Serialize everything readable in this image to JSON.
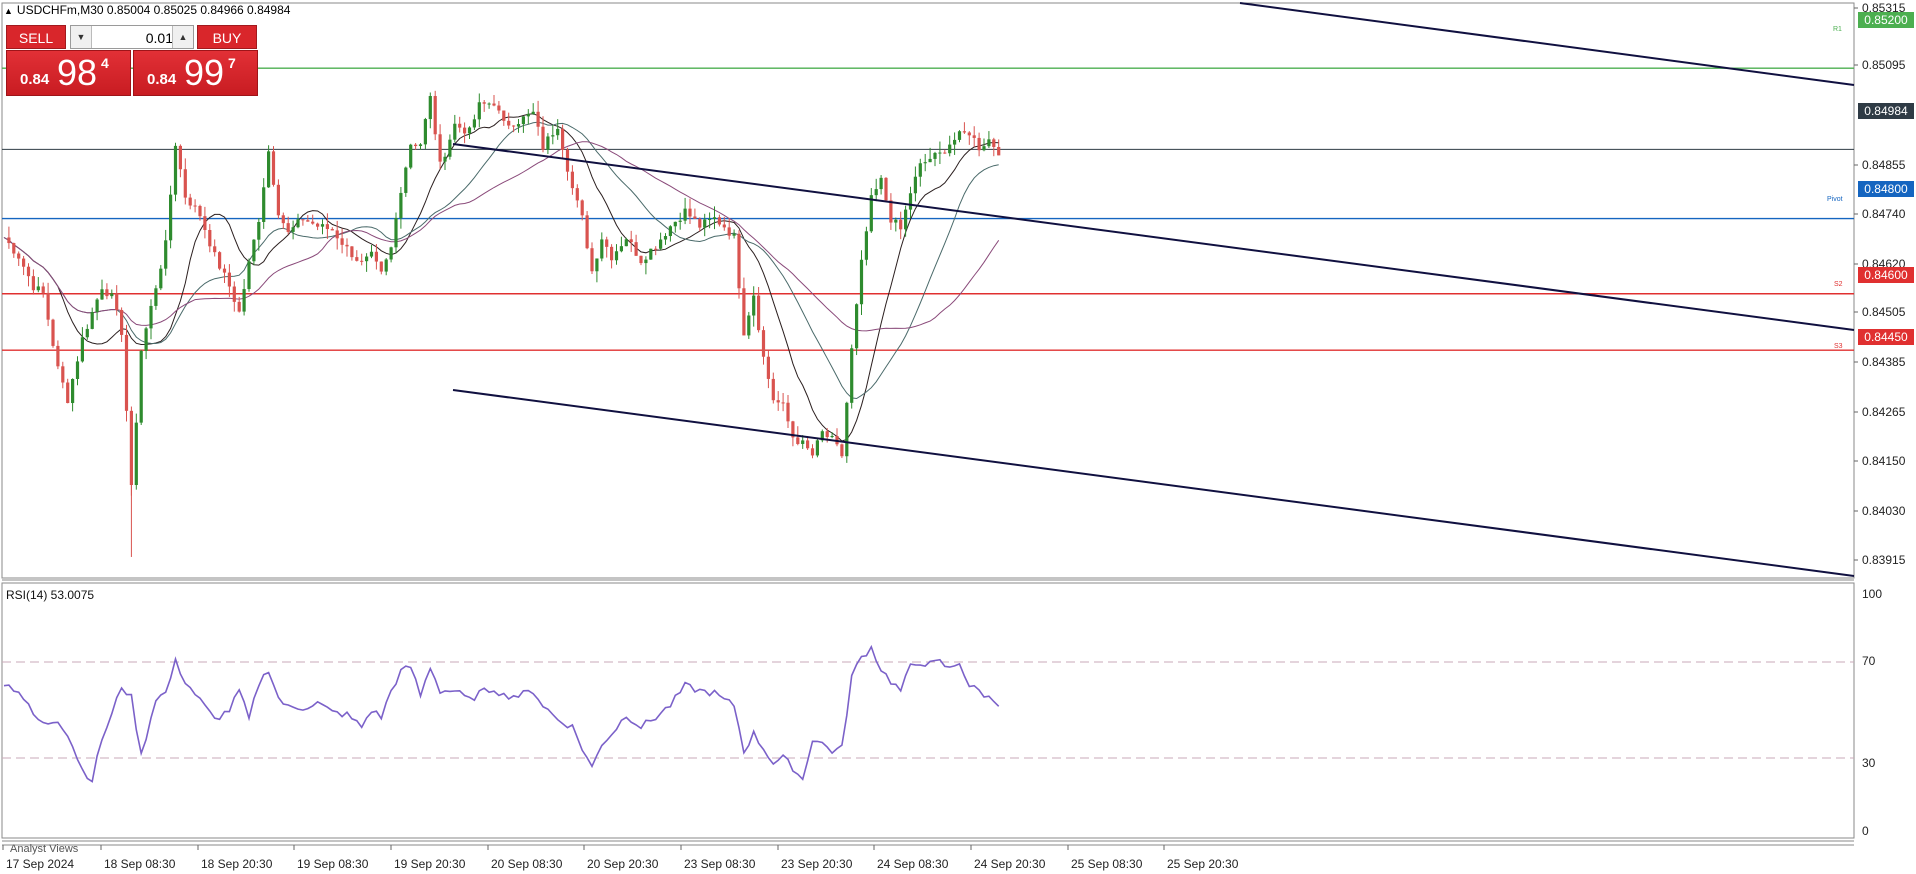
{
  "symbol_bar": {
    "text": "USDCHFm,M30  0.85004 0.85025 0.84966 0.84984"
  },
  "trade_panel": {
    "sell_label": "SELL",
    "buy_label": "BUY",
    "lot_value": "0.01",
    "sell_price": {
      "prefix": "0.84",
      "big": "98",
      "sup": "4"
    },
    "buy_price": {
      "prefix": "0.84",
      "big": "99",
      "sup": "7"
    }
  },
  "colors": {
    "bull": "#2e8b2e",
    "bear": "#d9534f",
    "r1": "#4caf50",
    "pivot": "#1565c0",
    "support": "#e03030",
    "current": "#2f3b45",
    "channel": "#101040",
    "rsi": "#7b61c9",
    "ma_fast": "#2b1f1f",
    "ma_mid": "#4a6a6a",
    "ma_slow": "#8a4a7a"
  },
  "level_tags": {
    "r1": {
      "price": "0.85200",
      "label": "R1"
    },
    "pivot": {
      "price": "0.84800",
      "label": "Pivot"
    },
    "s2": {
      "price": "0.84600",
      "label": "S2"
    },
    "s3": {
      "price": "0.84450",
      "label": "S3"
    },
    "current": {
      "price": "0.84984"
    }
  },
  "rsi_panel": {
    "title": "RSI(14) 53.0075",
    "levels": [
      "100",
      "70",
      "30",
      "0"
    ]
  },
  "analyst_views": "Analyst Views",
  "chart_data": [
    {
      "type": "candlestick",
      "title": "USDCHFm,M30",
      "ylim": [
        0.8386,
        0.8536
      ],
      "y_ticks": [
        "0.85315",
        "0.85095",
        "0.84855",
        "0.84740",
        "0.84620",
        "0.84505",
        "0.84385",
        "0.84265",
        "0.84150",
        "0.84030",
        "0.83915"
      ],
      "x_ticks": [
        "17 Sep 2024",
        "18 Sep 08:30",
        "18 Sep 20:30",
        "19 Sep 08:30",
        "19 Sep 20:30",
        "20 Sep 08:30",
        "20 Sep 20:30",
        "23 Sep 08:30",
        "23 Sep 20:30",
        "24 Sep 08:30",
        "24 Sep 20:30",
        "25 Sep 08:30",
        "25 Sep 20:30"
      ],
      "price_path": [
        [
          0,
          0.8475
        ],
        [
          3,
          0.847
        ],
        [
          6,
          0.8462
        ],
        [
          8,
          0.846
        ],
        [
          11,
          0.844
        ],
        [
          13,
          0.8432
        ],
        [
          16,
          0.8448
        ],
        [
          20,
          0.8462
        ],
        [
          22,
          0.8459
        ],
        [
          24,
          0.845
        ],
        [
          26,
          0.8408
        ],
        [
          28,
          0.8445
        ],
        [
          31,
          0.8462
        ],
        [
          33,
          0.8473
        ],
        [
          35,
          0.85
        ],
        [
          37,
          0.8486
        ],
        [
          40,
          0.8481
        ],
        [
          43,
          0.847
        ],
        [
          46,
          0.8462
        ],
        [
          48,
          0.8455
        ],
        [
          50,
          0.8468
        ],
        [
          52,
          0.848
        ],
        [
          54,
          0.8498
        ],
        [
          56,
          0.8482
        ],
        [
          58,
          0.8476
        ],
        [
          61,
          0.848
        ],
        [
          64,
          0.8478
        ],
        [
          67,
          0.8477
        ],
        [
          70,
          0.8472
        ],
        [
          73,
          0.8468
        ],
        [
          75,
          0.847
        ],
        [
          77,
          0.8465
        ],
        [
          79,
          0.8472
        ],
        [
          81,
          0.8488
        ],
        [
          83,
          0.85
        ],
        [
          85,
          0.85
        ],
        [
          87,
          0.8512
        ],
        [
          89,
          0.8494
        ],
        [
          92,
          0.8505
        ],
        [
          95,
          0.8503
        ],
        [
          97,
          0.851
        ],
        [
          100,
          0.8511
        ],
        [
          102,
          0.8505
        ],
        [
          105,
          0.8506
        ],
        [
          108,
          0.8508
        ],
        [
          110,
          0.8499
        ],
        [
          113,
          0.8505
        ],
        [
          116,
          0.8488
        ],
        [
          118,
          0.848
        ],
        [
          120,
          0.8466
        ],
        [
          122,
          0.8475
        ],
        [
          124,
          0.847
        ],
        [
          127,
          0.8475
        ],
        [
          130,
          0.8469
        ],
        [
          133,
          0.8473
        ],
        [
          136,
          0.8478
        ],
        [
          139,
          0.8482
        ],
        [
          142,
          0.8478
        ],
        [
          145,
          0.848
        ],
        [
          147,
          0.8478
        ],
        [
          149,
          0.8475
        ],
        [
          151,
          0.845
        ],
        [
          153,
          0.846
        ],
        [
          155,
          0.8443
        ],
        [
          157,
          0.8432
        ],
        [
          159,
          0.843
        ],
        [
          161,
          0.8422
        ],
        [
          163,
          0.842
        ],
        [
          165,
          0.8417
        ],
        [
          167,
          0.8423
        ],
        [
          169,
          0.8421
        ],
        [
          171,
          0.8417
        ],
        [
          173,
          0.8445
        ],
        [
          175,
          0.8468
        ],
        [
          177,
          0.8485
        ],
        [
          179,
          0.849
        ],
        [
          181,
          0.848
        ],
        [
          183,
          0.8477
        ],
        [
          185,
          0.8487
        ],
        [
          187,
          0.8494
        ],
        [
          189,
          0.8496
        ],
        [
          191,
          0.8497
        ],
        [
          193,
          0.85
        ],
        [
          195,
          0.8502
        ],
        [
          197,
          0.8503
        ],
        [
          199,
          0.8499
        ],
        [
          201,
          0.8501
        ],
        [
          203,
          0.8498
        ]
      ]
    },
    {
      "type": "line",
      "title": "RSI(14) 53.0075",
      "ylim": [
        0,
        100
      ],
      "guide_levels": [
        70,
        30
      ],
      "path": [
        [
          0,
          61
        ],
        [
          3,
          58
        ],
        [
          6,
          48
        ],
        [
          8,
          44
        ],
        [
          11,
          46
        ],
        [
          13,
          40
        ],
        [
          16,
          25
        ],
        [
          18,
          21
        ],
        [
          20,
          38
        ],
        [
          22,
          48
        ],
        [
          24,
          60
        ],
        [
          26,
          55
        ],
        [
          28,
          31
        ],
        [
          31,
          55
        ],
        [
          33,
          57
        ],
        [
          35,
          70
        ],
        [
          37,
          62
        ],
        [
          40,
          54
        ],
        [
          43,
          46
        ],
        [
          46,
          50
        ],
        [
          48,
          58
        ],
        [
          50,
          46
        ],
        [
          52,
          61
        ],
        [
          54,
          67
        ],
        [
          56,
          55
        ],
        [
          58,
          51
        ],
        [
          61,
          51
        ],
        [
          64,
          53
        ],
        [
          67,
          49
        ],
        [
          70,
          48
        ],
        [
          73,
          43
        ],
        [
          75,
          50
        ],
        [
          77,
          47
        ],
        [
          79,
          58
        ],
        [
          81,
          66
        ],
        [
          83,
          68
        ],
        [
          85,
          56
        ],
        [
          87,
          68
        ],
        [
          89,
          58
        ],
        [
          92,
          58
        ],
        [
          95,
          54
        ],
        [
          97,
          57
        ],
        [
          100,
          59
        ],
        [
          102,
          56
        ],
        [
          105,
          56
        ],
        [
          108,
          58
        ],
        [
          110,
          52
        ],
        [
          113,
          46
        ],
        [
          116,
          43
        ],
        [
          118,
          34
        ],
        [
          120,
          26
        ],
        [
          122,
          36
        ],
        [
          124,
          40
        ],
        [
          127,
          48
        ],
        [
          130,
          43
        ],
        [
          133,
          47
        ],
        [
          136,
          52
        ],
        [
          139,
          60
        ],
        [
          142,
          58
        ],
        [
          145,
          57
        ],
        [
          147,
          54
        ],
        [
          149,
          52
        ],
        [
          151,
          33
        ],
        [
          153,
          40
        ],
        [
          155,
          34
        ],
        [
          157,
          28
        ],
        [
          159,
          30
        ],
        [
          161,
          26
        ],
        [
          163,
          21
        ],
        [
          165,
          38
        ],
        [
          167,
          36
        ],
        [
          169,
          33
        ],
        [
          171,
          34
        ],
        [
          173,
          64
        ],
        [
          175,
          72
        ],
        [
          177,
          76
        ],
        [
          179,
          67
        ],
        [
          181,
          62
        ],
        [
          183,
          58
        ],
        [
          185,
          68
        ],
        [
          187,
          70
        ],
        [
          189,
          69
        ],
        [
          191,
          70
        ],
        [
          193,
          67
        ],
        [
          195,
          70
        ],
        [
          197,
          60
        ],
        [
          199,
          58
        ],
        [
          201,
          55
        ],
        [
          203,
          53
        ]
      ]
    }
  ]
}
